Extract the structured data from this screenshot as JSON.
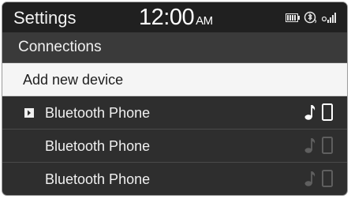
{
  "status_bar": {
    "title": "Settings",
    "time": "12:00",
    "ampm": "AM",
    "icons": [
      "battery-icon",
      "bluetooth-connected-icon",
      "signal-strength-icon"
    ]
  },
  "section": {
    "title": "Connections"
  },
  "list": {
    "add_new": "Add new device",
    "devices": [
      {
        "name": "Bluetooth Phone",
        "connected": true,
        "icons": [
          "music-audio-icon",
          "phone-icon"
        ]
      },
      {
        "name": "Bluetooth Phone",
        "connected": false,
        "icons": [
          "music-audio-icon",
          "phone-icon"
        ]
      },
      {
        "name": "Bluetooth Phone",
        "connected": false,
        "icons": [
          "music-audio-icon",
          "phone-icon"
        ]
      }
    ]
  },
  "colors": {
    "background": "#2e2e2e",
    "status_bar": "#202020",
    "header": "#3a3a3a",
    "selected_row": "#f5f5f5",
    "text": "#f0f0f0",
    "inactive_icon": "#6e6e6e"
  }
}
